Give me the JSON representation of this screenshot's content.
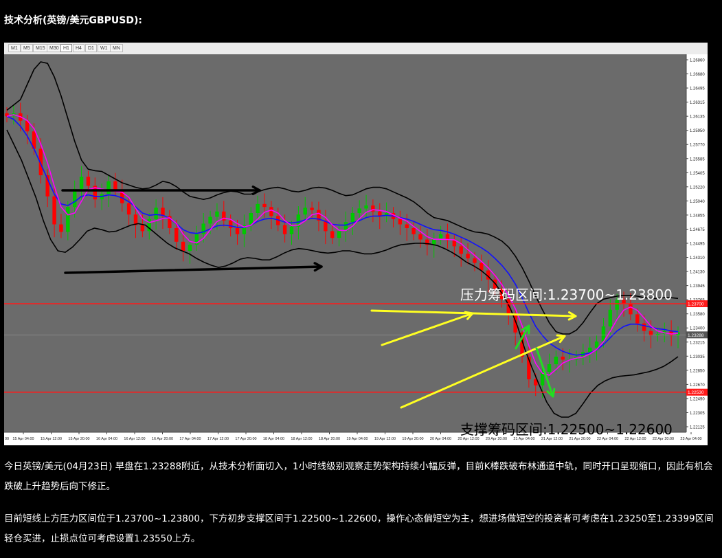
{
  "heading": "技术分析(英镑/美元GBPUSD):",
  "toolbar": {
    "timeframes": [
      "M1",
      "M5",
      "M15",
      "M30",
      "H1",
      "H4",
      "D1",
      "W1",
      "MN"
    ],
    "active": "H1"
  },
  "chart_data": {
    "type": "candlestick",
    "symbol": "GBPUSD",
    "timeframe": "H1",
    "ylim": [
      1.22,
      1.27
    ],
    "y_tick_labels": [
      "1.26860",
      "1.26680",
      "1.26495",
      "1.26315",
      "1.26135",
      "1.25950",
      "1.25770",
      "1.25585",
      "1.25405",
      "1.25220",
      "1.25040",
      "1.24855",
      "1.24675",
      "1.24495",
      "1.24310",
      "1.24130",
      "1.23945",
      "1.23765",
      "1.23580",
      "1.23400",
      "1.23215",
      "1.23035",
      "1.22850",
      "1.22670",
      "1.22490",
      "1.22305",
      "1.22125"
    ],
    "current_price_label": "1.23288",
    "resistance_line_label": "1.23700",
    "support_line_label": "1.22530",
    "x_tick_labels": [
      "15 Apr 04:00",
      "15 Apr 12:00",
      "15 Apr 20:00",
      "16 Apr 04:00",
      "16 Apr 12:00",
      "16 Apr 20:00",
      "17 Apr 04:00",
      "17 Apr 12:00",
      "17 Apr 20:00",
      "18 Apr 04:00",
      "18 Apr 12:00",
      "18 Apr 20:00",
      "19 Apr 04:00",
      "19 Apr 12:00",
      "19 Apr 20:00",
      "20 Apr 04:00",
      "20 Apr 12:00",
      "20 Apr 20:00",
      "21 Apr 04:00",
      "21 Apr 12:00",
      "21 Apr 20:00",
      "22 Apr 04:00",
      "22 Apr 12:00",
      "22 Apr 20:00",
      "23 Apr 04:00"
    ],
    "x_first_label": "00",
    "closes": [
      1.2618,
      1.2622,
      1.2612,
      1.2598,
      1.2575,
      1.254,
      1.2512,
      1.2475,
      1.2465,
      1.2498,
      1.2522,
      1.2538,
      1.2526,
      1.2508,
      1.2515,
      1.2532,
      1.252,
      1.2503,
      1.2488,
      1.2474,
      1.2466,
      1.2482,
      1.2497,
      1.2486,
      1.247,
      1.2452,
      1.244,
      1.2448,
      1.2462,
      1.2476,
      1.2485,
      1.2492,
      1.248,
      1.247,
      1.2462,
      1.2474,
      1.249,
      1.2502,
      1.2498,
      1.2486,
      1.2474,
      1.2462,
      1.2472,
      1.2488,
      1.2497,
      1.2494,
      1.248,
      1.2466,
      1.2457,
      1.2466,
      1.2478,
      1.249,
      1.2496,
      1.25,
      1.2492,
      1.2486,
      1.249,
      1.2482,
      1.2475,
      1.247,
      1.2462,
      1.2455,
      1.2448,
      1.2456,
      1.2462,
      1.2454,
      1.2446,
      1.2436,
      1.243,
      1.2424,
      1.2414,
      1.2402,
      1.239,
      1.2376,
      1.2356,
      1.2332,
      1.23,
      1.227,
      1.2262,
      1.228,
      1.229,
      1.23,
      1.2296,
      1.2296,
      1.23,
      1.2306,
      1.2312,
      1.232,
      1.234,
      1.2362,
      1.2375,
      1.237,
      1.2356,
      1.2344,
      1.2334,
      1.2328,
      1.233,
      1.2334,
      1.2328,
      1.2332
    ],
    "middle_band": [
      1.2618,
      1.2614,
      1.2605,
      1.2592,
      1.2575,
      1.2555,
      1.2535,
      1.2515,
      1.2502,
      1.25,
      1.2505,
      1.2512,
      1.2514,
      1.2512,
      1.2512,
      1.2514,
      1.2513,
      1.251,
      1.2505,
      1.2498,
      1.249,
      1.2487,
      1.2488,
      1.2487,
      1.2483,
      1.2476,
      1.2468,
      1.2464,
      1.2463,
      1.2465,
      1.2469,
      1.2473,
      1.2474,
      1.2473,
      1.2471,
      1.2471,
      1.2474,
      1.2479,
      1.2482,
      1.2483,
      1.2481,
      1.2478,
      1.2477,
      1.2478,
      1.2481,
      1.2483,
      1.2482,
      1.2479,
      1.2475,
      1.2474,
      1.2474,
      1.2477,
      1.248,
      1.2484,
      1.2486,
      1.2486,
      1.2487,
      1.2486,
      1.2484,
      1.2482,
      1.2479,
      1.2475,
      1.2471,
      1.2468,
      1.2467,
      1.2465,
      1.2462,
      1.2458,
      1.2454,
      1.2449,
      1.2444,
      1.2438,
      1.243,
      1.2421,
      1.241,
      1.2396,
      1.2378,
      1.2358,
      1.234,
      1.2328,
      1.2318,
      1.2312,
      1.2307,
      1.2304,
      1.2302,
      1.2303,
      1.2305,
      1.2309,
      1.2316,
      1.2325,
      1.2334,
      1.234,
      1.2343,
      1.2343,
      1.2341,
      1.2339,
      1.2337,
      1.2336,
      1.2334,
      1.2333
    ],
    "upper_band": [
      1.2626,
      1.2633,
      1.264,
      1.266,
      1.268,
      1.269,
      1.2688,
      1.267,
      1.2645,
      1.2615,
      1.2585,
      1.256,
      1.2548,
      1.2546,
      1.2545,
      1.254,
      1.2535,
      1.253,
      1.2527,
      1.2524,
      1.2522,
      1.2523,
      1.2527,
      1.2532,
      1.253,
      1.2525,
      1.2518,
      1.2512,
      1.251,
      1.2508,
      1.251,
      1.2514,
      1.2517,
      1.2519,
      1.2518,
      1.2515,
      1.2515,
      1.2518,
      1.2521,
      1.2523,
      1.2524,
      1.2522,
      1.2519,
      1.2518,
      1.252,
      1.2523,
      1.2524,
      1.2523,
      1.252,
      1.2516,
      1.2513,
      1.2514,
      1.2518,
      1.2522,
      1.2524,
      1.2524,
      1.2522,
      1.2518,
      1.2514,
      1.251,
      1.2505,
      1.2498,
      1.249,
      1.2484,
      1.2482,
      1.248,
      1.2476,
      1.2472,
      1.2468,
      1.2465,
      1.2464,
      1.2462,
      1.2458,
      1.2453,
      1.2445,
      1.2433,
      1.2418,
      1.24,
      1.238,
      1.2362,
      1.2345,
      1.2333,
      1.233,
      1.233,
      1.2335,
      1.2345,
      1.2358,
      1.237,
      1.2376,
      1.2378,
      1.238,
      1.2381,
      1.2381,
      1.238,
      1.2378,
      1.2377,
      1.2377,
      1.2378,
      1.2378,
      1.2377
    ],
    "lower_band": [
      1.26,
      1.258,
      1.256,
      1.2535,
      1.251,
      1.248,
      1.2455,
      1.244,
      1.2438,
      1.2445,
      1.2455,
      1.2466,
      1.247,
      1.2468,
      1.2465,
      1.2466,
      1.247,
      1.2474,
      1.2476,
      1.2474,
      1.2466,
      1.2458,
      1.245,
      1.2444,
      1.244,
      1.2436,
      1.243,
      1.2425,
      1.2421,
      1.2418,
      1.242,
      1.2424,
      1.2429,
      1.2431,
      1.243,
      1.2428,
      1.2428,
      1.2432,
      1.2437,
      1.2441,
      1.2443,
      1.2442,
      1.244,
      1.2438,
      1.2437,
      1.2438,
      1.244,
      1.244,
      1.2438,
      1.2436,
      1.2436,
      1.2438,
      1.2441,
      1.2445,
      1.2448,
      1.2449,
      1.245,
      1.245,
      1.2449,
      1.2447,
      1.2443,
      1.2438,
      1.2432,
      1.2425,
      1.242,
      1.2414,
      1.2406,
      1.2396,
      1.2382,
      1.2364,
      1.234,
      1.231,
      1.2285,
      1.2262,
      1.224,
      1.2225,
      1.222,
      1.222,
      1.2225,
      1.2238,
      1.2252,
      1.2262,
      1.2268,
      1.2272,
      1.2274,
      1.2275,
      1.2276,
      1.2278,
      1.228,
      1.2283,
      1.2287,
      1.2293,
      1.23
    ]
  },
  "annotations": {
    "resistance_text": "压力筹码区间:1.23700~1.23800",
    "support_text": "支撑筹码区间:1.22500~1.22600"
  },
  "colors": {
    "chart_bg": "#6b6b6b",
    "bull": "#00c800",
    "bear": "#ff0000",
    "upper_lower_band": "#000000",
    "middle_band": "#1010ff",
    "ma_fast": "#ff00ff",
    "key_line": "#ff1a1a",
    "arrow_black": "#000000",
    "arrow_yellow": "#ffff22",
    "arrow_green": "#22dd22"
  },
  "paragraphs": [
    "今日英镑/美元(04月23日) 早盘在1.23288附近，从技术分析面切入，1小时线级别观察走势架构持续小幅反弹，目前K棒跌破布林通道中轨，同时开口呈现缩口，因此有机会跌破上升趋势后向下修正。",
    "目前短线上方压力区间位于1.23700~1.23800，下方初步支撑区间于1.22500~1.22600，操作心态偏短空为主，想进场做短空的投资者可考虑在1.23250至1.23399区间轻仓买进，止损点位可考虑设置1.23550上方。"
  ]
}
